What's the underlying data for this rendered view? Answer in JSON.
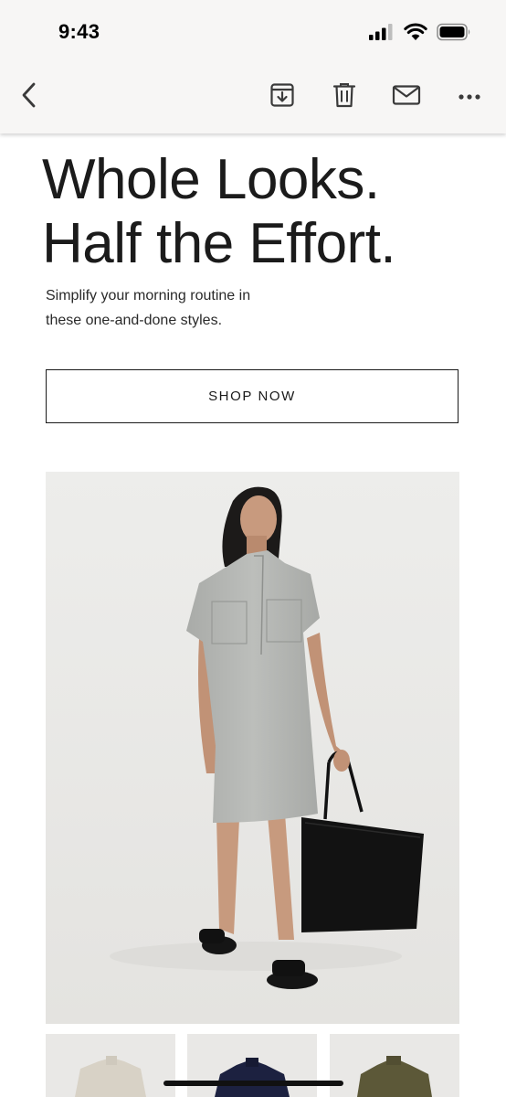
{
  "status_bar": {
    "time": "9:43",
    "icons": [
      "cellular-signal-icon",
      "wifi-icon",
      "battery-icon"
    ]
  },
  "toolbar": {
    "icons": [
      "back-chevron-icon",
      "archive-icon",
      "trash-icon",
      "mail-icon",
      "more-dots-icon"
    ]
  },
  "email": {
    "headline_line1": "Whole Looks.",
    "headline_line2": "Half the Effort.",
    "subtext_line1": "Simplify your morning routine in",
    "subtext_line2": "these one-and-done styles.",
    "cta_label": "SHOP NOW",
    "hero_image": "model-in-gray-shirt-dress-with-black-tote",
    "thumbnails": [
      "tan-dress-thumbnail",
      "navy-dress-thumbnail",
      "olive-dress-thumbnail"
    ]
  },
  "colors": {
    "text": "#1a1a1a",
    "header_bg": "#f7f6f5",
    "photo_bg": "#ececea",
    "dress": "#b4b6b3",
    "bag": "#121212"
  }
}
